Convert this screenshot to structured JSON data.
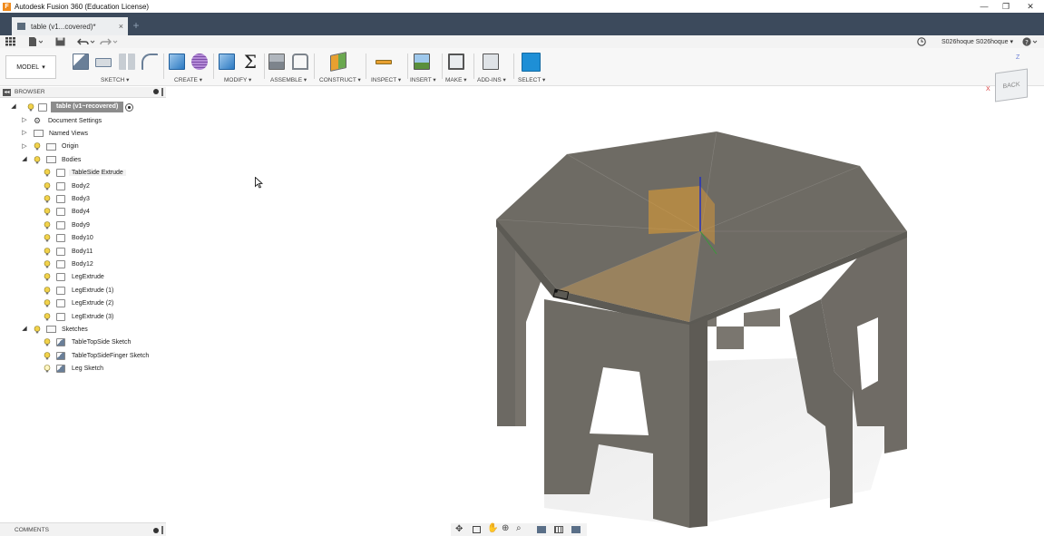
{
  "window": {
    "title": "Autodesk Fusion 360 (Education License)",
    "app_icon": "F"
  },
  "tab": {
    "label": "table (v1...covered)*",
    "close": "×",
    "new_tab": "+"
  },
  "user": {
    "name": "S026hoque S026hoque ▾"
  },
  "ribbon": {
    "workspace": "MODEL",
    "groups": [
      {
        "label": "SKETCH ▾"
      },
      {
        "label": "CREATE ▾"
      },
      {
        "label": "MODIFY ▾"
      },
      {
        "label": "ASSEMBLE ▾"
      },
      {
        "label": "CONSTRUCT ▾"
      },
      {
        "label": "INSPECT ▾"
      },
      {
        "label": "INSERT ▾"
      },
      {
        "label": "MAKE ▾"
      },
      {
        "label": "ADD-INS ▾"
      },
      {
        "label": "SELECT ▾"
      }
    ],
    "accent": "#1e8fd6"
  },
  "viewcube": {
    "label": "BACK",
    "axis_z": "Z",
    "axis_x": "X"
  },
  "browser": {
    "title": "BROWSER",
    "root": "table (v1~recovered)",
    "items": [
      {
        "label": "Document Settings"
      },
      {
        "label": "Named Views"
      },
      {
        "label": "Origin"
      },
      {
        "label": "Bodies"
      },
      {
        "label": "TableSide Extrude"
      },
      {
        "label": "Body2"
      },
      {
        "label": "Body3"
      },
      {
        "label": "Body4"
      },
      {
        "label": "Body9"
      },
      {
        "label": "Body10"
      },
      {
        "label": "Body11"
      },
      {
        "label": "Body12"
      },
      {
        "label": "LegExtrude"
      },
      {
        "label": "LegExtrude (1)"
      },
      {
        "label": "LegExtrude (2)"
      },
      {
        "label": "LegExtrude (3)"
      },
      {
        "label": "Sketches"
      },
      {
        "label": "TableTopSide Sketch"
      },
      {
        "label": "TableTopSideFinger Sketch"
      },
      {
        "label": "Leg Sketch"
      }
    ]
  },
  "comments": {
    "title": "COMMENTS"
  },
  "colors": {
    "tabbar": "#3c4a5c",
    "model": "#6e6b64",
    "model_dark": "#5a5852",
    "highlight": "#e8a030"
  }
}
